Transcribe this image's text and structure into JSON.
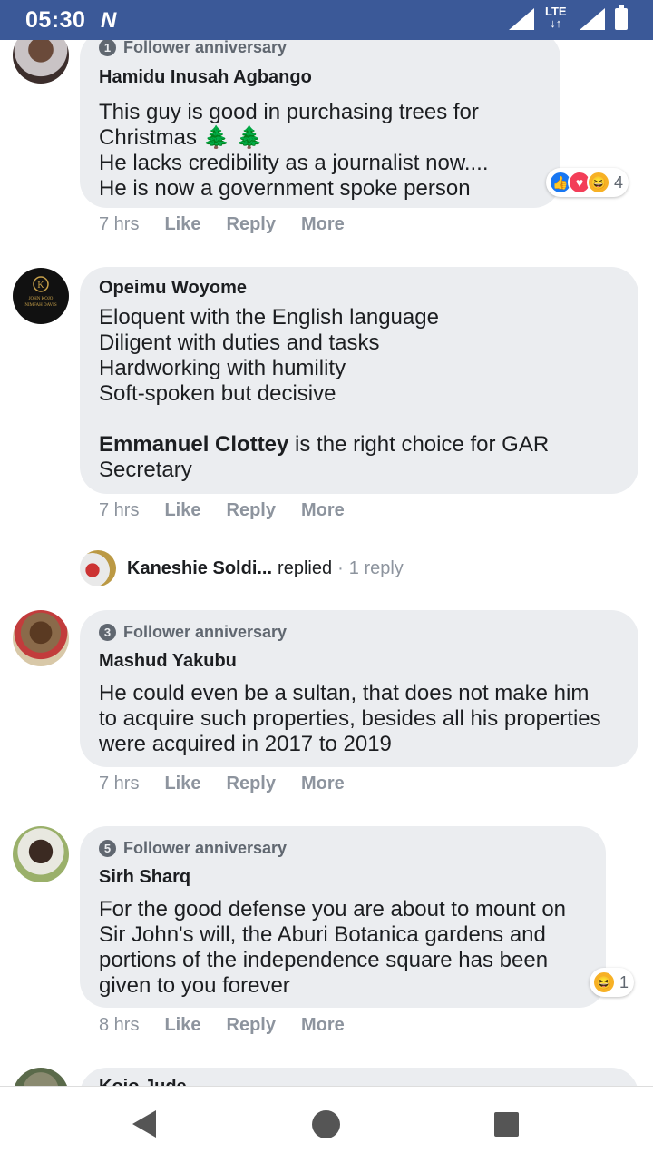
{
  "status_bar": {
    "time": "05:30",
    "network": "LTE"
  },
  "comments": [
    {
      "badge": {
        "number": "1",
        "label": "Follower anniversary"
      },
      "author": "Hamidu Inusah Agbango",
      "text": "This guy is good in purchasing trees for Christmas 🌲 🌲\nHe lacks credibility as a journalist now....\nHe is now a government spoke person",
      "time": "7 hrs",
      "like": "Like",
      "reply": "Reply",
      "more": "More",
      "reactions": {
        "count": "4",
        "types": [
          "like",
          "love",
          "haha"
        ]
      }
    },
    {
      "author": "Opeimu Woyome",
      "text_lines": "Eloquent with the English language\nDiligent with duties and tasks\nHardworking with humility\nSoft-spoken but decisive",
      "mention": "Emmanuel Clottey",
      "text_after": " is the right choice for GAR\nSecretary",
      "time": "7 hrs",
      "like": "Like",
      "reply": "Reply",
      "more": "More",
      "avatar_text": "JOHN KOJO NIMFAH DAVIS"
    },
    {
      "badge": {
        "number": "3",
        "label": "Follower anniversary"
      },
      "author": "Mashud Yakubu",
      "text": "He could even be a sultan, that does not make him\nto acquire such properties, besides all his properties\nwere acquired in 2017 to 2019",
      "time": "7 hrs",
      "like": "Like",
      "reply": "Reply",
      "more": "More"
    },
    {
      "badge": {
        "number": "5",
        "label": "Follower anniversary"
      },
      "author": "Sirh Sharq",
      "text": "For the good defense you are about to mount on\nSir John's will, the Aburi Botanica gardens and\nportions of the independence square has been\ngiven to you forever",
      "time": "8 hrs",
      "like": "Like",
      "reply": "Reply",
      "more": "More",
      "reactions": {
        "count": "1",
        "types": [
          "haha"
        ]
      }
    },
    {
      "author": "Kojo Jude"
    }
  ],
  "reply_summary": {
    "name": "Kaneshie Soldi...",
    "verb": "replied",
    "separator": "·",
    "count": "1 reply"
  },
  "nav": {
    "back": "back-icon",
    "home": "home-icon",
    "recents": "recents-icon"
  }
}
